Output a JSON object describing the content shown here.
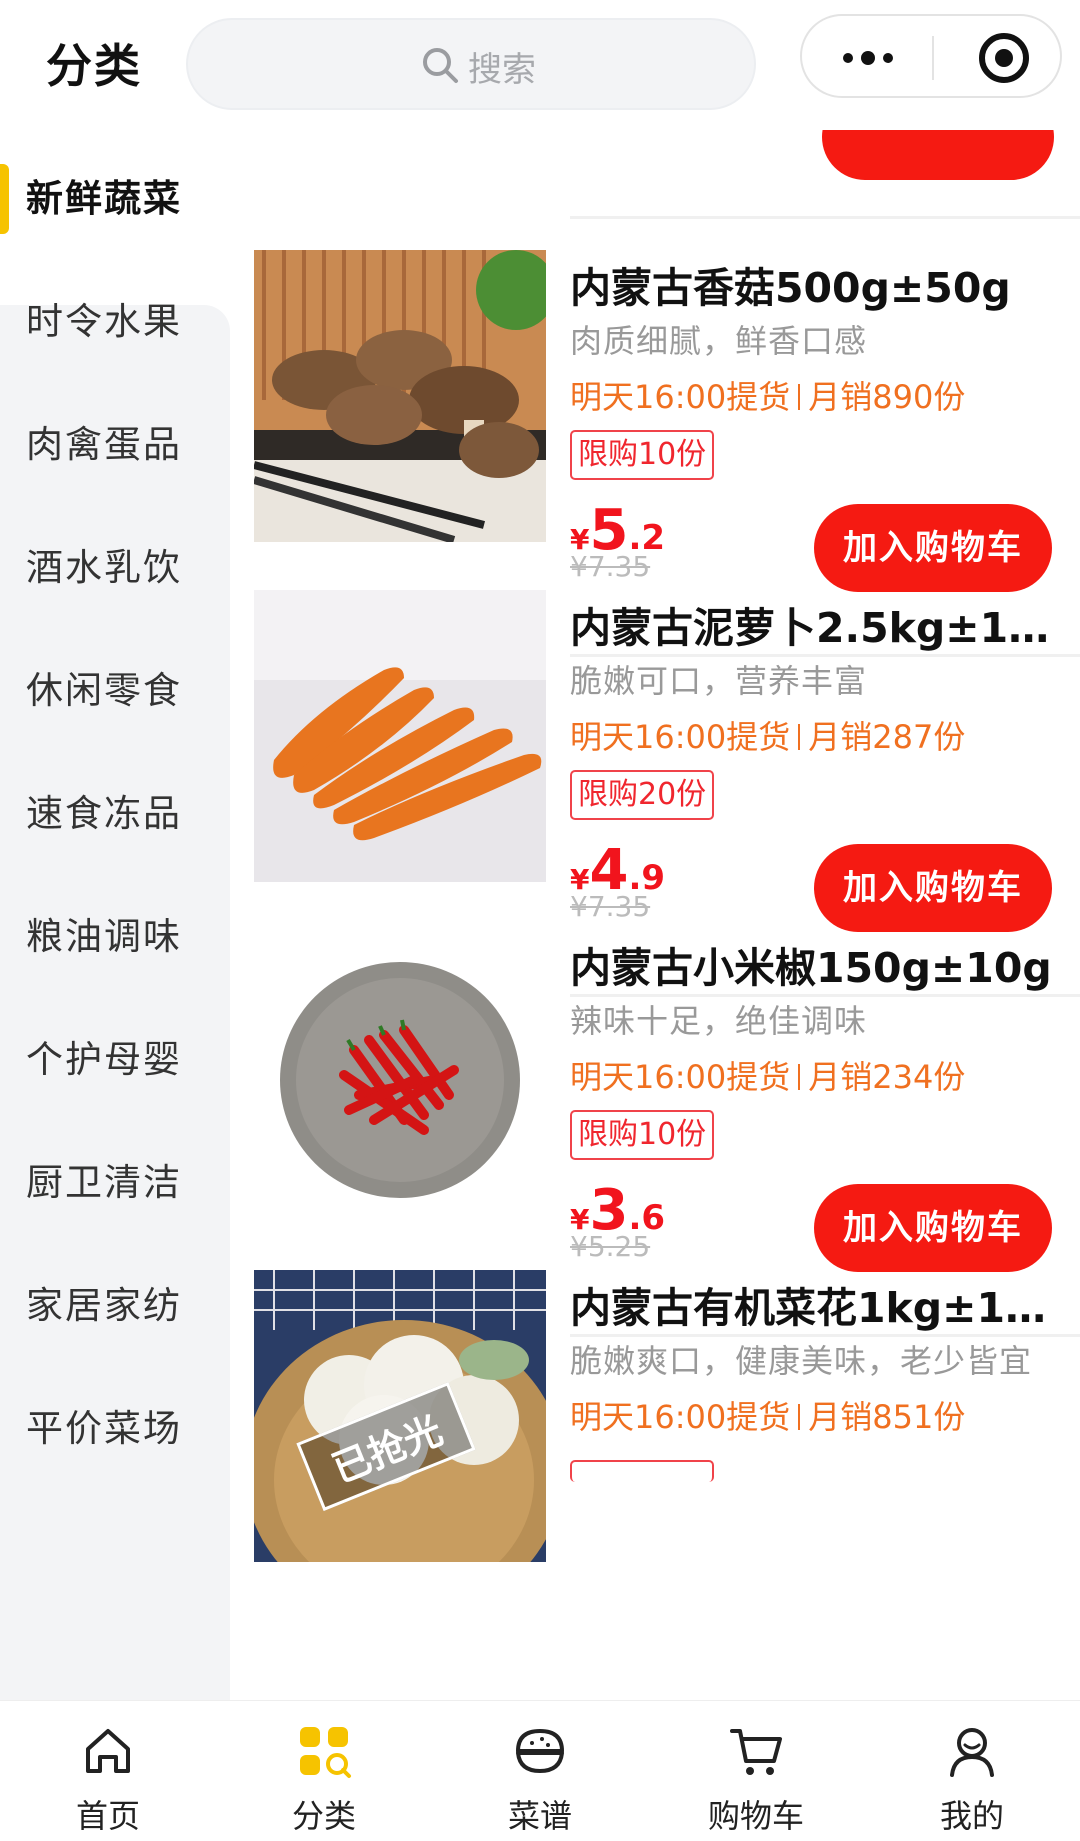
{
  "header": {
    "title": "分类",
    "search_placeholder": "搜索"
  },
  "sidebar": {
    "items": [
      {
        "label": "新鲜蔬菜",
        "active": true
      },
      {
        "label": "时令水果"
      },
      {
        "label": "肉禽蛋品"
      },
      {
        "label": "酒水乳饮"
      },
      {
        "label": "休闲零食"
      },
      {
        "label": "速食冻品"
      },
      {
        "label": "粮油调味"
      },
      {
        "label": "个护母婴"
      },
      {
        "label": "厨卫清洁"
      },
      {
        "label": "家居家纺"
      },
      {
        "label": "平价菜场"
      }
    ]
  },
  "products": [
    {
      "name": "内蒙古香菇500g±50g",
      "desc": "肉质细腻，鲜香口感",
      "pickup": "明天16:00提货",
      "sales": "月销890份",
      "limit": "限购10份",
      "price_int": "5",
      "price_dec": ".2",
      "yen": "¥",
      "orig": "¥7.35",
      "button": "加入购物车",
      "image": "mushrooms"
    },
    {
      "name": "内蒙古泥萝卜2.5kg±10...",
      "desc": "脆嫩可口，营养丰富",
      "pickup": "明天16:00提货",
      "sales": "月销287份",
      "limit": "限购20份",
      "price_int": "4",
      "price_dec": ".9",
      "yen": "¥",
      "orig": "¥7.35",
      "button": "加入购物车",
      "image": "carrots"
    },
    {
      "name": "内蒙古小米椒150g±10g",
      "desc": "辣味十足，绝佳调味",
      "pickup": "明天16:00提货",
      "sales": "月销234份",
      "limit": "限购10份",
      "price_int": "3",
      "price_dec": ".6",
      "yen": "¥",
      "orig": "¥5.25",
      "button": "加入购物车",
      "image": "chili-peppers"
    },
    {
      "name": "内蒙古有机菜花1kg±10...",
      "desc": "脆嫩爽口，健康美味，老少皆宜",
      "pickup": "明天16:00提货",
      "sales": "月销851份",
      "soldout": "已抢光",
      "image": "cauliflower"
    }
  ],
  "tabbar": [
    {
      "label": "首页",
      "icon": "home-icon"
    },
    {
      "label": "分类",
      "icon": "category-icon",
      "active": true
    },
    {
      "label": "菜谱",
      "icon": "recipe-bowl-icon"
    },
    {
      "label": "购物车",
      "icon": "cart-icon"
    },
    {
      "label": "我的",
      "icon": "user-icon"
    }
  ],
  "colors": {
    "accent": "#f6c300",
    "price": "#f1141d",
    "button": "#f51a12",
    "meta": "#f07020"
  }
}
